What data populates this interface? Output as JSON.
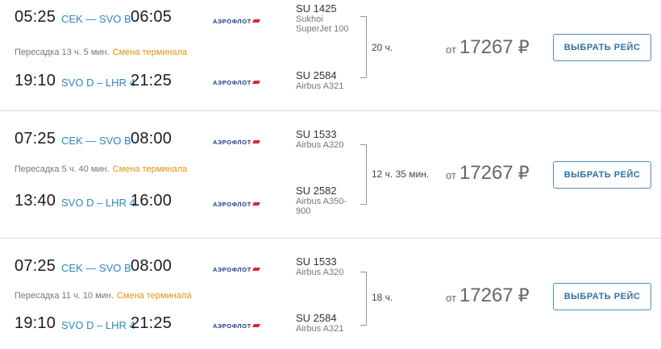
{
  "results": [
    {
      "legs": [
        {
          "dep_time": "05:25",
          "route": "CEK — SVO B",
          "arr_time": "06:05",
          "airline": "АЭРОФЛОТ",
          "flight_no": "SU 1425",
          "aircraft": "Sukhoi SuperJet 100"
        },
        {
          "dep_time": "19:10",
          "route": "SVO D – LHR 4",
          "arr_time": "21:25",
          "airline": "АЭРОФЛОТ",
          "flight_no": "SU 2584",
          "aircraft": "Airbus A321"
        }
      ],
      "transfer": "Пересадка 13 ч. 5 мин.",
      "terminal_change": "Смена терминала",
      "duration": "20 ч.",
      "price_prefix": "от",
      "price": "17267",
      "currency": "₽",
      "button_label": "ВЫБРАТЬ РЕЙС"
    },
    {
      "legs": [
        {
          "dep_time": "07:25",
          "route": "CEK — SVO B",
          "arr_time": "08:00",
          "airline": "АЭРОФЛОТ",
          "flight_no": "SU 1533",
          "aircraft": "Airbus A320"
        },
        {
          "dep_time": "13:40",
          "route": "SVO D – LHR 4",
          "arr_time": "16:00",
          "airline": "АЭРОФЛОТ",
          "flight_no": "SU 2582",
          "aircraft": "Airbus A350-900"
        }
      ],
      "transfer": "Пересадка 5 ч. 40 мин.",
      "terminal_change": "Смена терминала",
      "duration": "12 ч. 35 мин.",
      "price_prefix": "от",
      "price": "17267",
      "currency": "₽",
      "button_label": "ВЫБРАТЬ РЕЙС"
    },
    {
      "legs": [
        {
          "dep_time": "07:25",
          "route": "CEK — SVO B",
          "arr_time": "08:00",
          "airline": "АЭРОФЛОТ",
          "flight_no": "SU 1533",
          "aircraft": "Airbus A320"
        },
        {
          "dep_time": "19:10",
          "route": "SVO D – LHR 4",
          "arr_time": "21:25",
          "airline": "АЭРОФЛОТ",
          "flight_no": "SU 2584",
          "aircraft": "Airbus A321"
        }
      ],
      "transfer": "Пересадка 11 ч. 10 мин.",
      "terminal_change": "Смена терминала",
      "duration": "18 ч.",
      "price_prefix": "от",
      "price": "17267",
      "currency": "₽",
      "button_label": "ВЫБРАТЬ РЕЙС"
    }
  ],
  "colors": {
    "route": "#2f86c2",
    "terminal_change": "#e5900c",
    "button_border": "#4a90c2",
    "divider": "#d9d9d9"
  }
}
